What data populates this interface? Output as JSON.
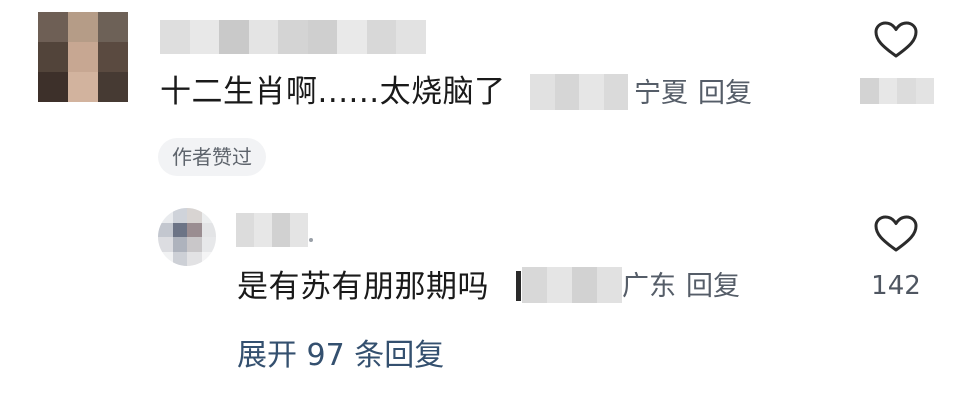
{
  "comment": {
    "avatar": "redacted-avatar",
    "username": "",
    "text": "十二生肖啊......太烧脑了",
    "location": "宁夏",
    "reply_label": "回复",
    "like_icon": "heart-outline-icon",
    "author_liked_label": "作者赞过"
  },
  "reply": {
    "avatar": "redacted-avatar",
    "username": "",
    "text": "是有苏有朋那期吗",
    "location": "广东",
    "reply_label": "回复",
    "like_icon": "heart-outline-icon",
    "like_count": "142"
  },
  "expand": {
    "label": "展开 97 条回复"
  },
  "colors": {
    "text_primary": "#1a1a1a",
    "text_meta": "#555d68",
    "link": "#34506f",
    "badge_bg": "#f2f3f5"
  }
}
